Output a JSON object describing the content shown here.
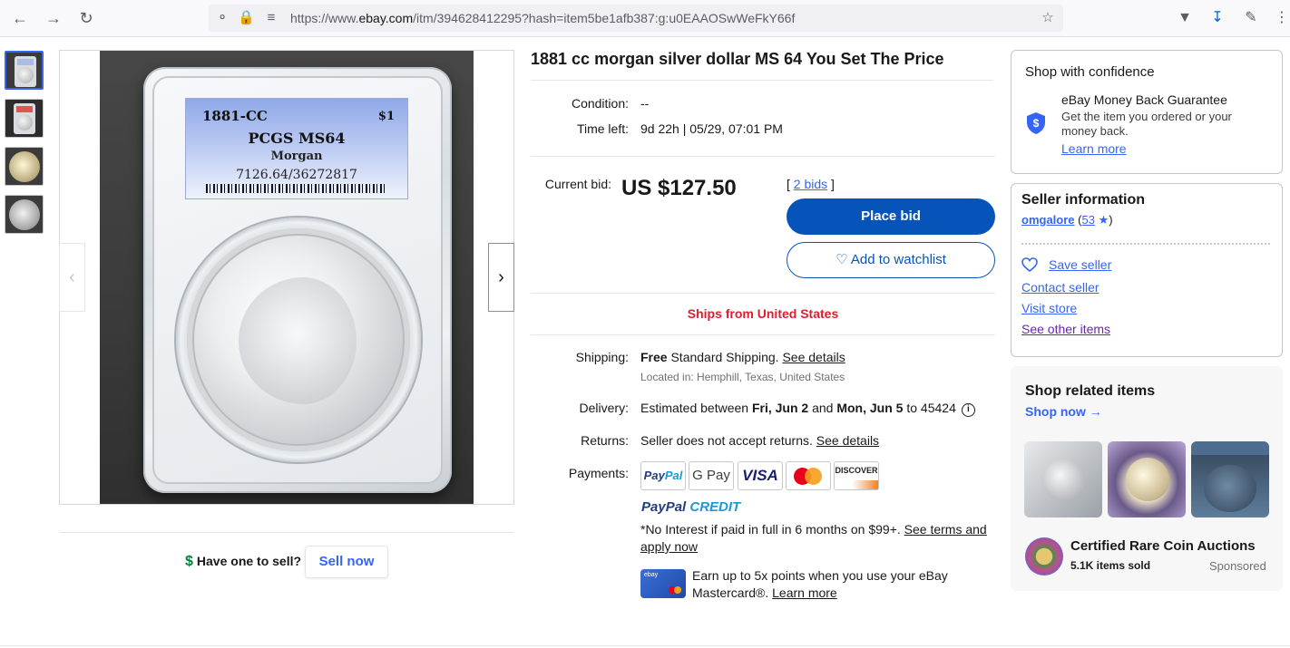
{
  "browser": {
    "url_prefix": "https://www.",
    "url_host": "ebay.com",
    "url_rest": "/itm/394628412295?hash=item5be1afb387:g:u0EAAOSwWeFkY66f"
  },
  "gallery": {
    "label_year": "1881-CC",
    "label_denom": "$1",
    "label_grade": "PCGS MS64",
    "label_type": "Morgan",
    "label_cert": "7126.64/36272817"
  },
  "listing": {
    "title": "1881 cc morgan silver dollar MS 64 You Set The Price",
    "condition_label": "Condition:",
    "condition_value": "--",
    "time_left_label": "Time left:",
    "time_left_value": "9d 22h | 05/29, 07:01 PM",
    "current_bid_label": "Current bid:",
    "current_bid_value": "US $127.50",
    "bids_open": "[",
    "bids_link": "2 bids",
    "bids_close": "]",
    "place_bid": "Place bid",
    "add_watchlist": "Add to watchlist",
    "ships_from": "Ships from United States",
    "shipping_label": "Shipping:",
    "shipping_free": "Free",
    "shipping_text": " Standard Shipping.",
    "shipping_details": "See details",
    "located": "Located in: Hemphill, Texas, United States",
    "delivery_label": "Delivery:",
    "delivery_pre": "Estimated between ",
    "delivery_d1": "Fri, Jun 2",
    "delivery_mid": " and ",
    "delivery_d2": "Mon, Jun 5",
    "delivery_post": " to 45424",
    "returns_label": "Returns:",
    "returns_text": "Seller does not accept returns.",
    "returns_details": "See details",
    "payments_label": "Payments:",
    "pay_paypal_a": "Pay",
    "pay_paypal_b": "Pal",
    "pay_gpay": "G Pay",
    "pay_visa": "VISA",
    "pay_discover": "DISCOVER",
    "ppcredit_a": "PayPal",
    "ppcredit_b": " CREDIT",
    "ppcredit_text": "*No Interest if paid in full in 6 months on $99+.",
    "ppcredit_link": "See terms and apply now",
    "mc_card_logo": "ebay",
    "mc_text": "Earn up to 5x points when you use your eBay Mastercard®.",
    "mc_link": "Learn more"
  },
  "sell": {
    "dollar_icon": "$",
    "question": "Have one to sell?",
    "button": "Sell now"
  },
  "confidence": {
    "title": "Shop with confidence",
    "heading": "eBay Money Back Guarantee",
    "text": "Get the item you ordered or your money back.",
    "link": "Learn more"
  },
  "seller": {
    "title": "Seller information",
    "name": "omgalore",
    "feedback_open": " (",
    "feedback": "53",
    "feedback_close": ")",
    "save": "Save seller",
    "contact": "Contact seller",
    "visit": "Visit store",
    "other": "See other items"
  },
  "related": {
    "title": "Shop related items",
    "shop_now": "Shop now",
    "store_name": "Certified Rare Coin Auctions",
    "store_sold": "5.1K items sold",
    "sponsored": "Sponsored"
  },
  "colors": {
    "accent": "#3665f3",
    "place_bid_bg": "#0654ba",
    "ships_red": "#dd1e31"
  }
}
